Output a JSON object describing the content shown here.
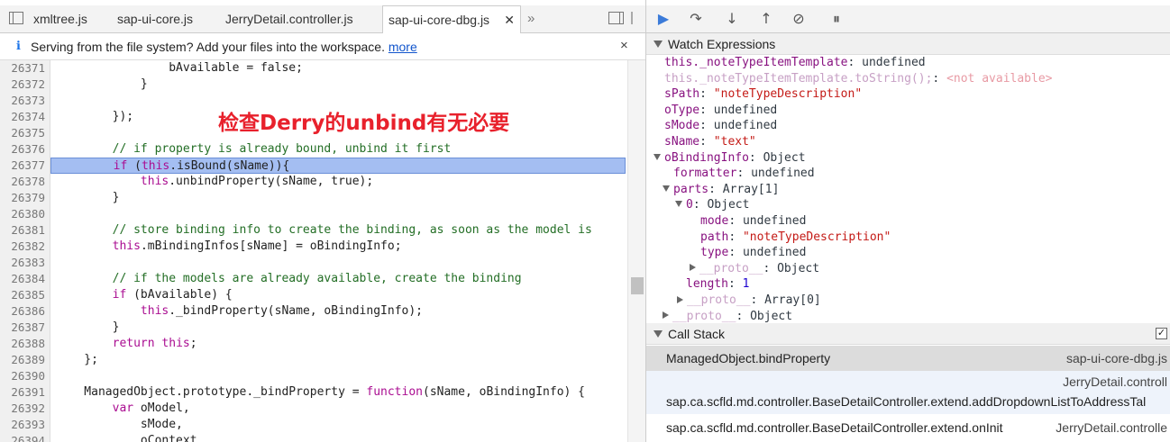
{
  "editor_tabs": [
    {
      "label": "xmltree.js"
    },
    {
      "label": "sap-ui-core.js"
    },
    {
      "label": "JerryDetail.controller.js"
    },
    {
      "label": "sap-ui-core-dbg.js",
      "active": true
    }
  ],
  "tab_overflow": "»",
  "infobar": {
    "text": "Serving from the file system? Add your files into the workspace.",
    "link": "more",
    "close": "×"
  },
  "annotation": "检查Derry的unbind有无必要",
  "code_lines": [
    {
      "n": "26371",
      "text": "                bAvailable = false;"
    },
    {
      "n": "26372",
      "text": "            }"
    },
    {
      "n": "26373",
      "text": ""
    },
    {
      "n": "26374",
      "text": "        });"
    },
    {
      "n": "26375",
      "text": ""
    },
    {
      "n": "26376",
      "text": "        // if property is already bound, unbind it first"
    },
    {
      "n": "26377",
      "text": "        if (this.isBound(sName)){"
    },
    {
      "n": "26378",
      "text": "            this.unbindProperty(sName, true);"
    },
    {
      "n": "26379",
      "text": "        }"
    },
    {
      "n": "26380",
      "text": ""
    },
    {
      "n": "26381",
      "text": "        // store binding info to create the binding, as soon as the model is"
    },
    {
      "n": "26382",
      "text": "        this.mBindingInfos[sName] = oBindingInfo;"
    },
    {
      "n": "26383",
      "text": ""
    },
    {
      "n": "26384",
      "text": "        // if the models are already available, create the binding"
    },
    {
      "n": "26385",
      "text": "        if (bAvailable) {"
    },
    {
      "n": "26386",
      "text": "            this._bindProperty(sName, oBindingInfo);"
    },
    {
      "n": "26387",
      "text": "        }"
    },
    {
      "n": "26388",
      "text": "        return this;"
    },
    {
      "n": "26389",
      "text": "    };"
    },
    {
      "n": "26390",
      "text": ""
    },
    {
      "n": "26391",
      "text": "    ManagedObject.prototype._bindProperty = function(sName, oBindingInfo) {"
    },
    {
      "n": "26392",
      "text": "        var oModel,"
    },
    {
      "n": "26393",
      "text": "            sMode,"
    },
    {
      "n": "26394",
      "text": "            oContext,"
    }
  ],
  "debugger_toolbar": {
    "resume": "resume-icon",
    "step_over": "step-over-icon",
    "step_into": "step-into-icon",
    "step_out": "step-out-icon",
    "deactivate": "deactivate-breakpoints-icon",
    "pause_exceptions": "pause-on-exceptions-icon"
  },
  "watch": {
    "title": "Watch Expressions",
    "items": [
      {
        "name": "this._noteTypeItemTemplate",
        "value": "undefined"
      },
      {
        "name": "this._noteTypeItemTemplate.toString();",
        "value": "<not available>"
      },
      {
        "name": "sPath",
        "value": "\"noteTypeDescription\""
      },
      {
        "name": "oType",
        "value": "undefined"
      },
      {
        "name": "sMode",
        "value": "undefined"
      },
      {
        "name": "sName",
        "value": "\"text\""
      },
      {
        "name": "oBindingInfo",
        "value": "Object"
      },
      {
        "name": "formatter",
        "value": "undefined"
      },
      {
        "name": "parts",
        "value": "Array[1]"
      },
      {
        "name": "0",
        "value": "Object"
      },
      {
        "name": "mode",
        "value": "undefined"
      },
      {
        "name": "path",
        "value": "\"noteTypeDescription\""
      },
      {
        "name": "type",
        "value": "undefined"
      },
      {
        "name": "__proto__",
        "value": "Object"
      },
      {
        "name": "length",
        "value": "1"
      },
      {
        "name": "__proto__",
        "value": "Array[0]"
      },
      {
        "name": "__proto__",
        "value": "Object"
      }
    ]
  },
  "call_stack": {
    "title": "Call Stack",
    "frames": [
      {
        "name": "ManagedObject.bindProperty",
        "location": "sap-ui-core-dbg.js"
      },
      {
        "name": "sap.ca.scfld.md.controller.BaseDetailController.extend.addDropdownListToAddressTal",
        "location": "JerryDetail.controll"
      },
      {
        "name": "sap.ca.scfld.md.controller.BaseDetailController.extend.onInit",
        "location": "JerryDetail.controlle"
      }
    ]
  },
  "colors": {
    "highlight": "#a4bef2",
    "annotation": "#e8212c",
    "keyword": "#aa0d91",
    "comment": "#236e25",
    "watch_name": "#881280",
    "string": "#c41a16"
  }
}
